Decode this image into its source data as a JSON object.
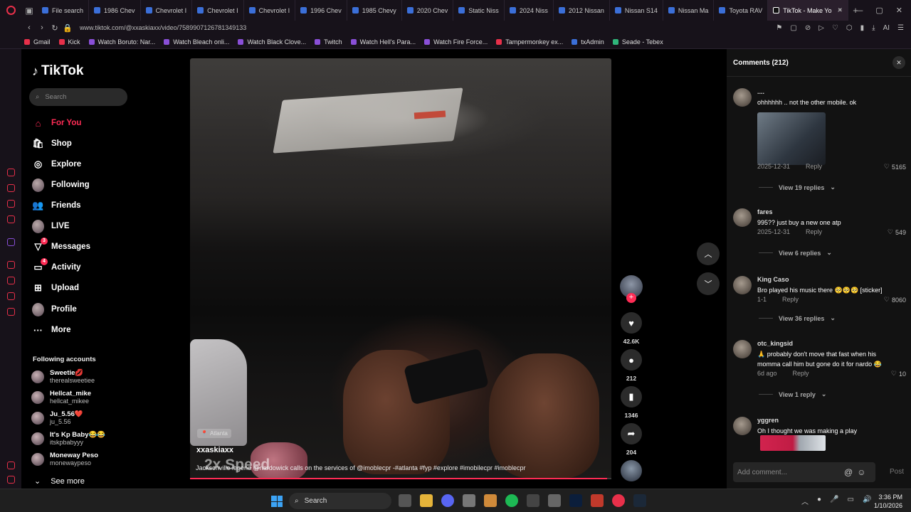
{
  "browser": {
    "tabs": [
      {
        "label": "File search",
        "active": false
      },
      {
        "label": "1986 Chev",
        "active": false
      },
      {
        "label": "Chevrolet I",
        "active": false
      },
      {
        "label": "Chevrolet I",
        "active": false
      },
      {
        "label": "Chevrolet I",
        "active": false
      },
      {
        "label": "1996 Chev",
        "active": false
      },
      {
        "label": "1985 Chevy",
        "active": false
      },
      {
        "label": "2020 Chev",
        "active": false
      },
      {
        "label": "Static Niss",
        "active": false
      },
      {
        "label": "2024 Niss",
        "active": false
      },
      {
        "label": "2012 Nissan",
        "active": false
      },
      {
        "label": "Nissan S14",
        "active": false
      },
      {
        "label": "Nissan Ma",
        "active": false
      },
      {
        "label": "Toyota RAV",
        "active": false
      },
      {
        "label": "TikTok - Make Yo",
        "active": true
      }
    ],
    "url": "www.tiktok.com/@xxaskiaxx/video/7589907126781349133",
    "bookmarks": [
      {
        "label": "Gmail",
        "color": "#e8304a"
      },
      {
        "label": "Kick",
        "color": "#e8304a"
      },
      {
        "label": "Watch Boruto: Nar...",
        "color": "#8a4fd8"
      },
      {
        "label": "Watch Bleach onli...",
        "color": "#8a4fd8"
      },
      {
        "label": "Watch Black Clove...",
        "color": "#8a4fd8"
      },
      {
        "label": "Twitch",
        "color": "#8a4fd8"
      },
      {
        "label": "Watch Hell's Para...",
        "color": "#8a4fd8"
      },
      {
        "label": "Watch Fire Force...",
        "color": "#8a4fd8"
      },
      {
        "label": "Tampermonkey ex...",
        "color": "#e8304a"
      },
      {
        "label": "txAdmin",
        "color": "#3b6fd8"
      },
      {
        "label": "Seade - Tebex",
        "color": "#2fb57a"
      }
    ]
  },
  "tiktok": {
    "logo": "TikTok",
    "search_placeholder": "Search",
    "nav": [
      {
        "label": "For You",
        "icon": "home-icon",
        "glyph": "⌂",
        "active": true,
        "badge": ""
      },
      {
        "label": "Shop",
        "icon": "shop-icon",
        "glyph": "🛍",
        "active": false,
        "badge": ""
      },
      {
        "label": "Explore",
        "icon": "compass-icon",
        "glyph": "◎",
        "active": false,
        "badge": ""
      },
      {
        "label": "Following",
        "icon": "avatar-icon",
        "glyph": "",
        "active": false,
        "badge": ""
      },
      {
        "label": "Friends",
        "icon": "friends-icon",
        "glyph": "👥",
        "active": false,
        "badge": ""
      },
      {
        "label": "LIVE",
        "icon": "live-icon",
        "glyph": "",
        "active": false,
        "badge": ""
      },
      {
        "label": "Messages",
        "icon": "messages-icon",
        "glyph": "▽",
        "active": false,
        "badge": "3"
      },
      {
        "label": "Activity",
        "icon": "activity-icon",
        "glyph": "▭",
        "active": false,
        "badge": "4"
      },
      {
        "label": "Upload",
        "icon": "upload-icon",
        "glyph": "⊞",
        "active": false,
        "badge": ""
      },
      {
        "label": "Profile",
        "icon": "profile-avatar-icon",
        "glyph": "",
        "active": false,
        "badge": ""
      },
      {
        "label": "More",
        "icon": "more-icon",
        "glyph": "···",
        "active": false,
        "badge": ""
      }
    ],
    "following_title": "Following accounts",
    "following": [
      {
        "name": "Sweetie💋",
        "username": "therealsweetiee"
      },
      {
        "name": "Hellcat_mike",
        "username": "hellcat_mikee"
      },
      {
        "name": "Ju_5.56❤️",
        "username": "ju_5.56"
      },
      {
        "name": "It's Kp Baby😂😂",
        "username": "itskpbabyyy"
      },
      {
        "name": "Moneway Peso",
        "username": "monewaypeso"
      }
    ],
    "see_more": "See more"
  },
  "video": {
    "location": "Atlanta",
    "author": "xxaskiaxx",
    "overlay_text": "2x Speed",
    "caption": "Jacksonville legend @nardowick calls on the services of @imoblecpr -#atlanta #fyp #explore #imobilecpr #imoblecpr",
    "progress": 0.99,
    "actions": {
      "likes": "42.6K",
      "comments": "212",
      "saves": "1346",
      "shares": "204"
    }
  },
  "comments_panel": {
    "title": "Comments (212)",
    "input_placeholder": "Add comment...",
    "post_label": "Post",
    "items": [
      {
        "user": "....",
        "text": "ohhhhhh .. not the other mobile. ok",
        "date": "2025-12-31",
        "reply": "Reply",
        "likes": "5165",
        "view_replies": "View 19 replies"
      },
      {
        "user": "fares",
        "text": "995?? just buy a new one atp",
        "date": "2025-12-31",
        "reply": "Reply",
        "likes": "549",
        "view_replies": "View 6 replies"
      },
      {
        "user": "King Caso",
        "text": "Bro played his music there 🥺🥺🥺 [sticker]",
        "date": "1-1",
        "reply": "Reply",
        "likes": "8060",
        "view_replies": "View 36 replies"
      },
      {
        "user": "otc_kingsid",
        "text": "🙏 probably don't move that fast when his momma call him but gone do it for nardo 😂",
        "date": "6d ago",
        "reply": "Reply",
        "likes": "10",
        "view_replies": "View 1 reply"
      },
      {
        "user": "yggren",
        "text": "Oh I thought we was making a play",
        "date": "",
        "reply": "",
        "likes": "",
        "view_replies": ""
      }
    ]
  },
  "taskbar": {
    "search_placeholder": "Search",
    "time": "3:36 PM",
    "date": "1/10/2026"
  },
  "colors": {
    "accent": "#fe2c55",
    "opera_red": "#e8304a"
  }
}
